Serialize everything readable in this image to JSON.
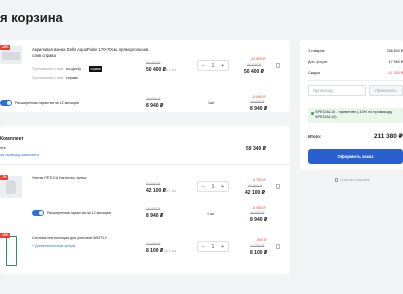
{
  "page": {
    "title": "я корзина"
  },
  "items": [
    {
      "name": "Акриловая ванна Dello AquaPulse 170-70см, прямоугольная, слив справа",
      "badge": "",
      "meta_label_1": "Приложение к ним:",
      "meta_value_1": "по-щетку",
      "tag": "справа",
      "meta_label_2": "Приложение к ним:",
      "meta_value_2": "справа",
      "old_price": "56 800 ₽",
      "price": "50 400 ₽",
      "unit": "за 1 шт",
      "qty": "1",
      "discount": "-12 600 ₽",
      "total_old": "56 800 ₽",
      "total": "50 400 ₽"
    }
  ],
  "warranty_1": {
    "label": "Расширенная гарантия на 12 месяцев",
    "qty": "1шт",
    "old_price": "16 800 ₽",
    "price": "8 940 ₽",
    "discount": "-5 060 ₽",
    "total_old": "16 800 ₽",
    "total": "8 940 ₽"
  },
  "kit": {
    "title": "Комплект",
    "subtitle": "нта",
    "link": "на страницу комплекта",
    "total": "59 340 ₽",
    "toilet": {
      "name": "Унитаз PETLEA Harmonia, флеш",
      "old_price": "40 600 ₽",
      "price": "42 100 ₽",
      "unit": "за 1 шт",
      "qty": "1",
      "discount": "-4 700 ₽",
      "total_old": "46 800 ₽",
      "total": "42 100 ₽"
    },
    "warranty": {
      "label": "Расширенная гарантия на 12 месяцев",
      "qty": "1 шт",
      "old_price": "16 800 ₽",
      "price": "8 940 ₽",
      "discount": "-5 060 ₽",
      "total_old": "16 800 ₽",
      "total": "8 940 ₽"
    },
    "install": {
      "badge": "-10%",
      "name": "Система инсталляции для унитазов WATFLY",
      "link": "+ Дополнительные услуги",
      "old_price": "14 900 ₽",
      "price": "8 100 ₽",
      "unit": "за 1 шт",
      "qty": "1",
      "discount": "-900 ₽",
      "total_old": "14 900 ₽",
      "total": "8 100 ₽"
    }
  },
  "badges": {
    "first": "-16%",
    "kit": "-10%",
    "toilet": "-7%"
  },
  "summary": {
    "rows": [
      {
        "label": "3 товаров",
        "value": "256 800 ₽",
        "red": false
      },
      {
        "label": "Доп. услуги",
        "value": "17 960 ₽",
        "red": false
      },
      {
        "label": "Скидка",
        "value": "-47 420 ₽",
        "red": true
      }
    ],
    "promo_placeholder": "Промокод",
    "promo_apply": "Применить",
    "promo_message": "SPECIAL10 - применён (-10% по промокоду SPECIAL10)",
    "total_label": "Итого:",
    "total_value": "211 380 ₽",
    "checkout": "Оформить заказ",
    "clear": "Очистить корзину"
  },
  "colors": {
    "accent": "#2a5fcf",
    "danger": "#e63b2e",
    "success": "#2ea44f"
  }
}
